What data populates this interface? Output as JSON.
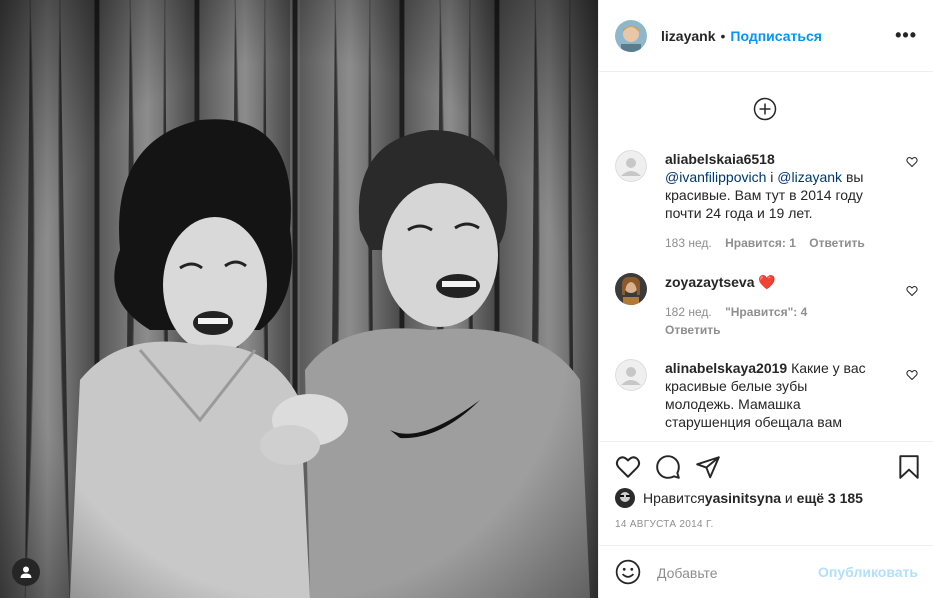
{
  "header": {
    "username": "lizayank",
    "separator": "•",
    "follow_label": "Подписаться",
    "more_label": "•••"
  },
  "comments": [
    {
      "username": "aliabelskaia6518",
      "mention1": "@ivanfilippovich",
      "mid": " і ",
      "mention2": "@lizayank",
      "text": " вы красивые. Вам тут в 2014 году почти 24 года и 19 лет.",
      "age": "183 нед.",
      "likes": "Нравится: 1",
      "reply": "Ответить"
    },
    {
      "username": "zoyazaytseva",
      "text": "❤️",
      "age": "182 нед.",
      "likes": "\"Нравится\": 4",
      "reply": "Ответить"
    },
    {
      "username": "alinabelskaya2019",
      "text": " Какие у вас красивые белые зубы молодежь. Мамашка старушенция обещала вам"
    }
  ],
  "likes": {
    "prefix": "Нравится ",
    "user": "yasinitsyna",
    "mid": " и ",
    "count": "ещё 3 185"
  },
  "date": "14 АВГУСТА 2014 Г.",
  "add_comment": {
    "placeholder": "Добавьте",
    "publish_label": "Опубликовать"
  },
  "colors": {
    "link": "#0095f6",
    "mention": "#00376b",
    "muted": "#8e8e8e",
    "publish_disabled": "#b2dffc"
  }
}
